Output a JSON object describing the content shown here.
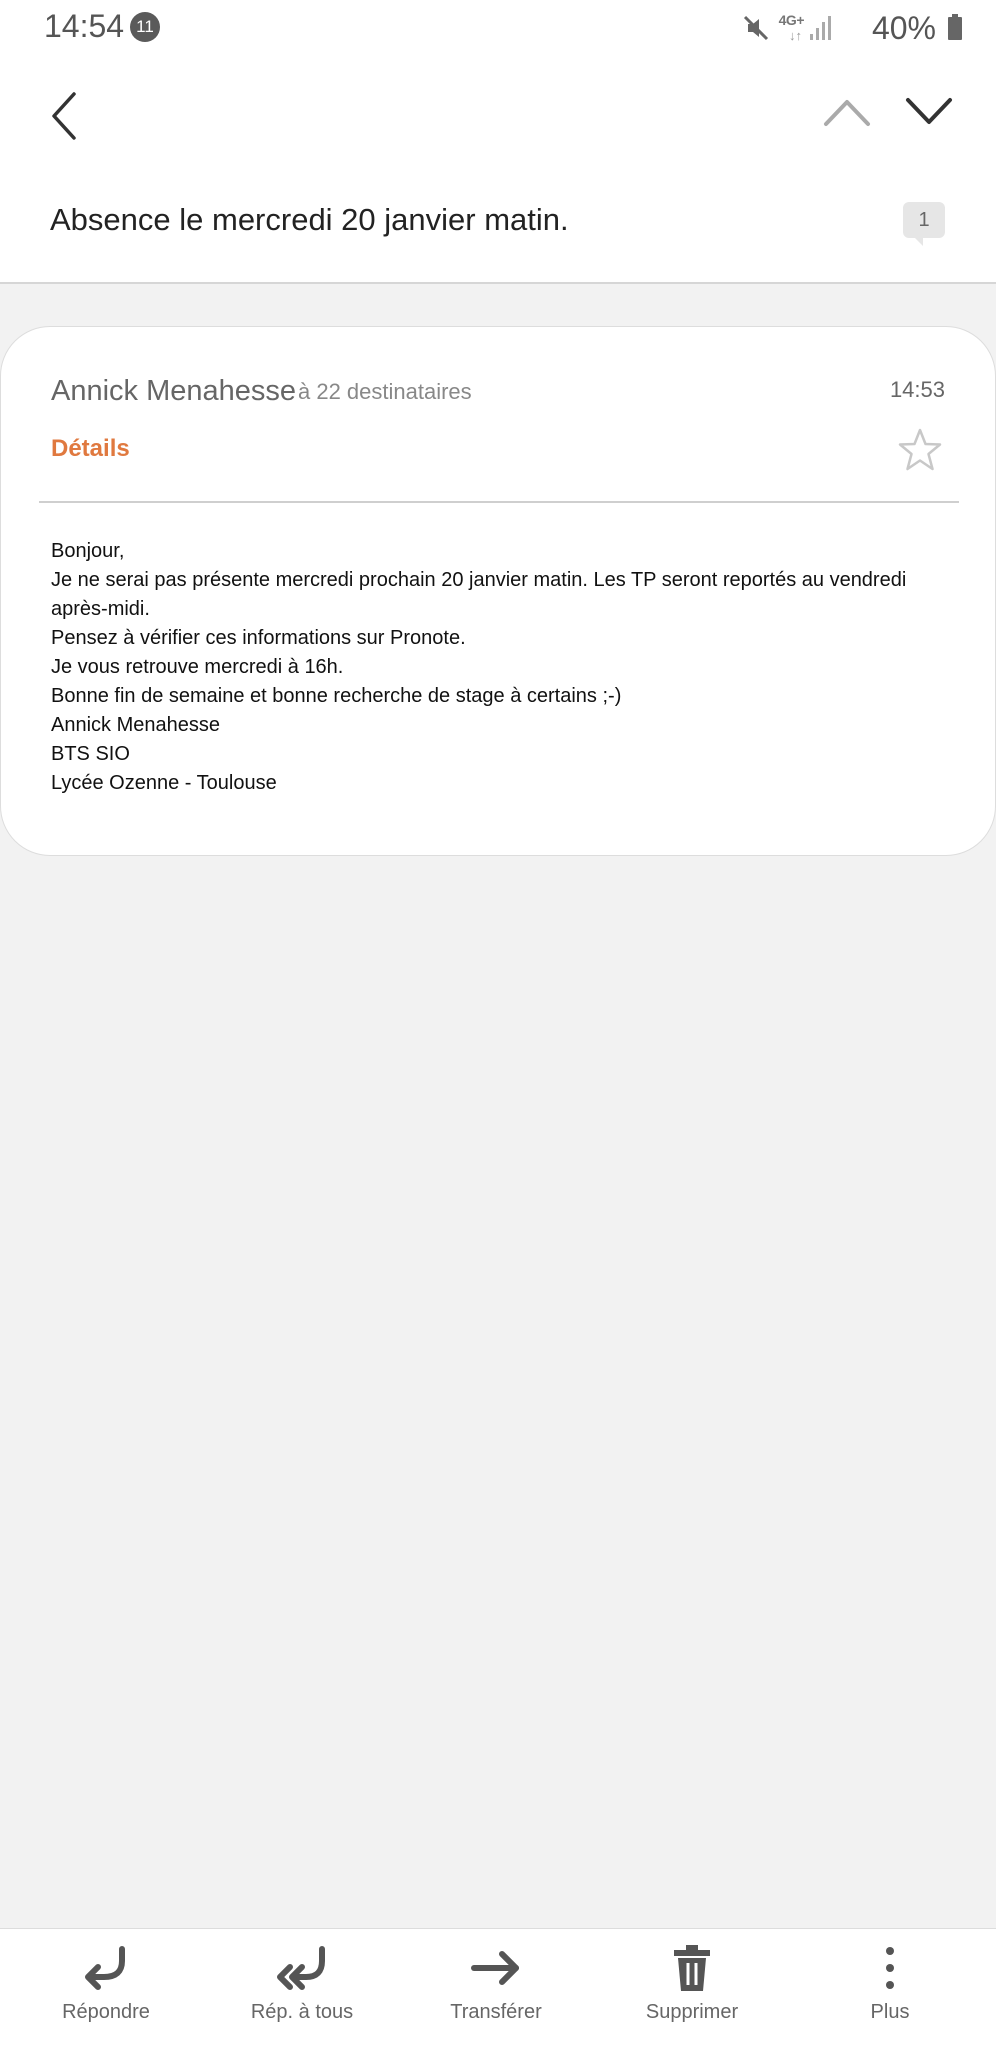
{
  "status_bar": {
    "time": "14:54",
    "notification_count": "11",
    "network": "4G+",
    "network_arrows": "↓↑",
    "battery": "40%"
  },
  "header": {
    "subject": "Absence le mercredi 20 janvier matin.",
    "thread_count": "1"
  },
  "message": {
    "sender": "Annick Menahesse",
    "recipients": "à 22 destinataires",
    "time": "14:53",
    "details_label": "Détails",
    "body_lines": [
      "Bonjour,",
      "Je ne serai pas présente mercredi prochain 20 janvier matin. Les TP seront reportés au vendredi après-midi.",
      "Pensez à vérifier ces informations sur Pronote.",
      "Je vous retrouve mercredi à 16h.",
      "Bonne fin de semaine et bonne recherche de stage à certains ;-)",
      "Annick Menahesse",
      "BTS SIO",
      "Lycée Ozenne - Toulouse"
    ]
  },
  "actions": {
    "reply": "Répondre",
    "reply_all": "Rép. à tous",
    "forward": "Transférer",
    "delete": "Supprimer",
    "more": "Plus"
  },
  "colors": {
    "accent": "#e0793f",
    "background": "#f2f2f2"
  }
}
